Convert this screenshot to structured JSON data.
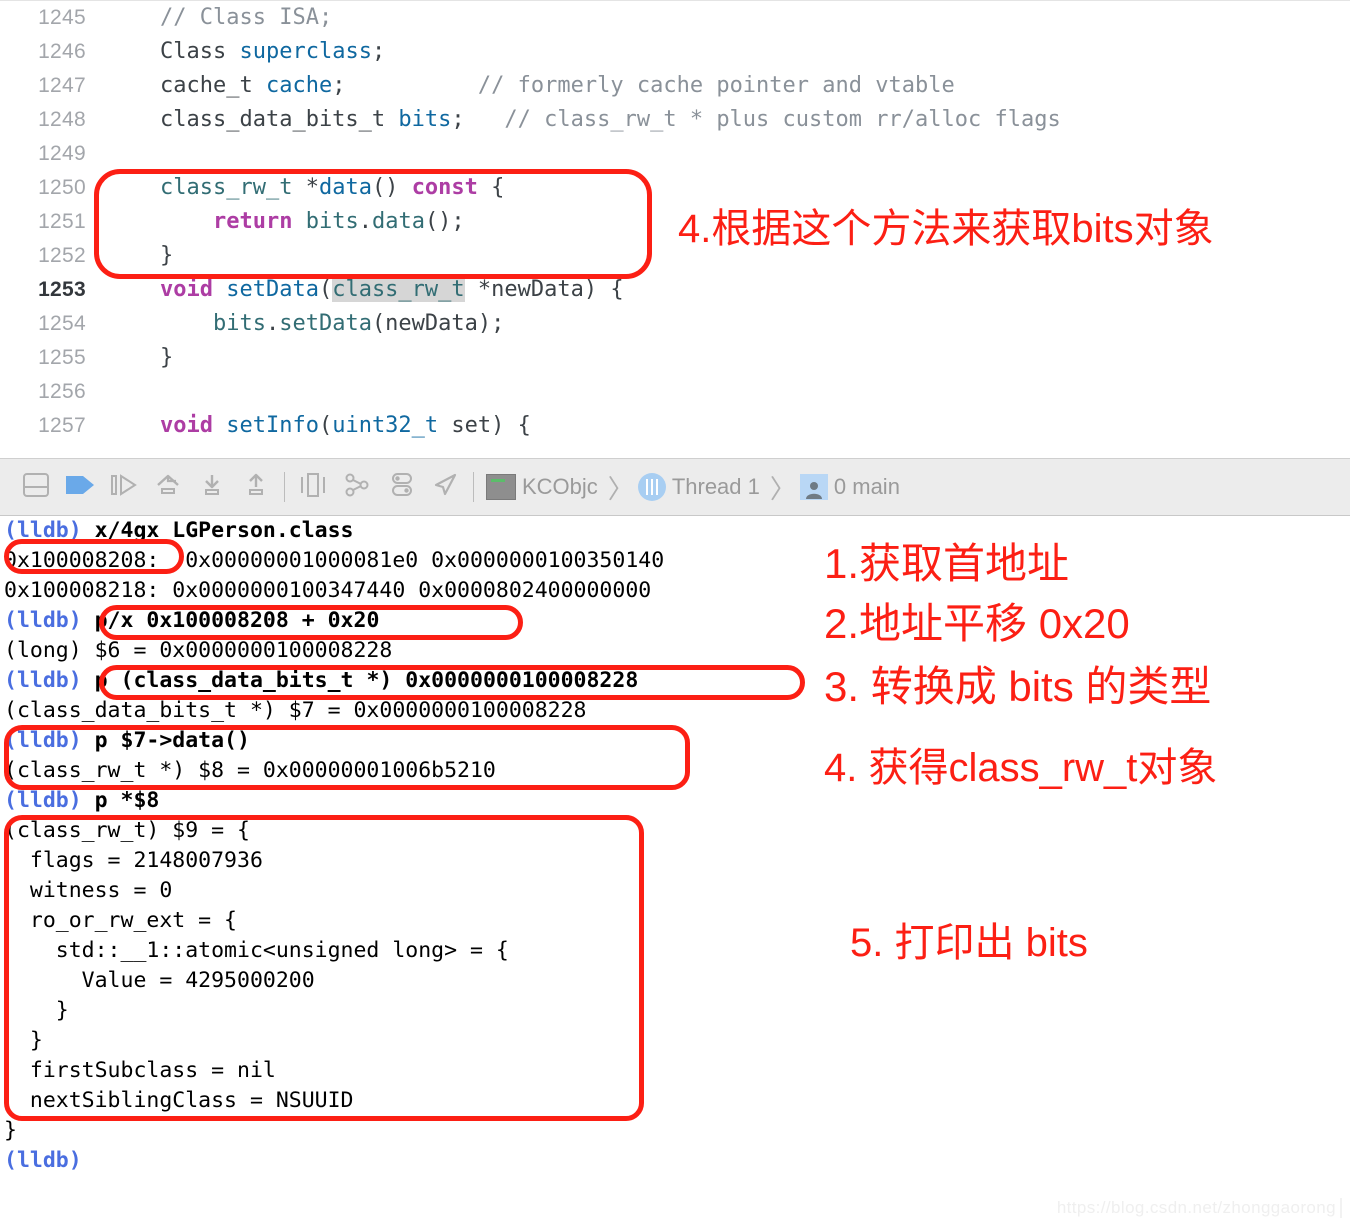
{
  "editor": {
    "lines": [
      {
        "num": "1245",
        "current": false,
        "html": "<span class='cmt'>// Class ISA;</span>"
      },
      {
        "num": "1246",
        "current": false,
        "html": "<span class='typ'>Class </span><span class='blu'>superclass</span>;"
      },
      {
        "num": "1247",
        "current": false,
        "html": "<span class='typ'>cache_t </span><span class='blu'>cache</span>;          <span class='cmt'>// formerly cache pointer and vtable</span>"
      },
      {
        "num": "1248",
        "current": false,
        "html": "<span class='typ'>class_data_bits_t </span><span class='blu'>bits</span>;   <span class='cmt'>// class_rw_t * plus custom rr/alloc flags</span>"
      },
      {
        "num": "1249",
        "current": false,
        "html": ""
      },
      {
        "num": "1250",
        "current": false,
        "html": "<span class='fn'>class_rw_t</span> *<span class='blu'>data</span>() <span class='kw'>const</span> {"
      },
      {
        "num": "1251",
        "current": false,
        "html": "    <span class='kw'>return</span> <span class='fn'>bits</span>.<span class='fn'>data</span>();"
      },
      {
        "num": "1252",
        "current": false,
        "html": "}"
      },
      {
        "num": "1253",
        "current": true,
        "html": "<span class='kw'>void</span> <span class='blu'>setData</span>(<span class='hl fn'>class_rw_t</span> *newData) {"
      },
      {
        "num": "1254",
        "current": false,
        "html": "    <span class='fn'>bits</span>.<span class='fn'>setData</span>(newData);"
      },
      {
        "num": "1255",
        "current": false,
        "html": "}"
      },
      {
        "num": "1256",
        "current": false,
        "html": ""
      },
      {
        "num": "1257",
        "current": false,
        "html": "<span class='kw'>void</span> <span class='blu'>setInfo</span>(<span class='blu'>uint32_t</span> set) {"
      }
    ],
    "plain_lines": [
      "// Class ISA;",
      "Class superclass;",
      "cache_t cache;          // formerly cache pointer and vtable",
      "class_data_bits_t bits;   // class_rw_t * plus custom rr/alloc flags",
      "",
      "class_rw_t *data() const {",
      "    return bits.data();",
      "}",
      "void setData(class_rw_t *newData) {",
      "    bits.setData(newData);",
      "}",
      "",
      "void setInfo(uint32_t set) {"
    ]
  },
  "toolbar": {
    "buttons": [
      {
        "name": "hide-debug-area-button",
        "icon": "panel-icon"
      },
      {
        "name": "continue-button",
        "icon": "continue-icon"
      },
      {
        "name": "step-over-button",
        "icon": "step-over-icon"
      },
      {
        "name": "step-into-button",
        "icon": "step-into-icon"
      },
      {
        "name": "step-down-button",
        "icon": "step-down-icon"
      },
      {
        "name": "step-out-button",
        "icon": "step-out-icon"
      },
      {
        "name": "view-debugging-button",
        "icon": "view-debug-icon"
      },
      {
        "name": "view-hierarchy-button",
        "icon": "hierarchy-icon"
      },
      {
        "name": "debug-settings-button",
        "icon": "toggles-icon"
      },
      {
        "name": "simulate-location-button",
        "icon": "location-arrow-icon"
      }
    ],
    "breadcrumb": {
      "process": "KCObjc",
      "thread": "Thread 1",
      "frame": "0 main",
      "separator": "〉"
    }
  },
  "console": {
    "lines": [
      {
        "prompt": "(lldb)",
        "cmd": " x/4gx LGPerson.class",
        "bold": true
      },
      {
        "prompt": "",
        "cmd": "0x100008208:  0x00000001000081e0 0x0000000100350140",
        "bold": false
      },
      {
        "prompt": "",
        "cmd": "0x100008218: 0x0000000100347440 0x0000802400000000",
        "bold": false
      },
      {
        "prompt": "(lldb)",
        "cmd": " p/x 0x100008208 + 0x20",
        "bold": true
      },
      {
        "prompt": "",
        "cmd": "(long) $6 = 0x0000000100008228",
        "bold": false
      },
      {
        "prompt": "(lldb)",
        "cmd": " p (class_data_bits_t *) 0x0000000100008228",
        "bold": true
      },
      {
        "prompt": "",
        "cmd": "(class_data_bits_t *) $7 = 0x0000000100008228",
        "bold": false
      },
      {
        "prompt": "(lldb)",
        "cmd": " p $7->data()",
        "bold": true
      },
      {
        "prompt": "",
        "cmd": "(class_rw_t *) $8 = 0x00000001006b5210",
        "bold": false
      },
      {
        "prompt": "(lldb)",
        "cmd": " p *$8",
        "bold": true
      },
      {
        "prompt": "",
        "cmd": "(class_rw_t) $9 = {",
        "bold": false
      },
      {
        "prompt": "",
        "cmd": "  flags = 2148007936",
        "bold": false
      },
      {
        "prompt": "",
        "cmd": "  witness = 0",
        "bold": false
      },
      {
        "prompt": "",
        "cmd": "  ro_or_rw_ext = {",
        "bold": false
      },
      {
        "prompt": "",
        "cmd": "    std::__1::atomic<unsigned long> = {",
        "bold": false
      },
      {
        "prompt": "",
        "cmd": "      Value = 4295000200",
        "bold": false
      },
      {
        "prompt": "",
        "cmd": "    }",
        "bold": false
      },
      {
        "prompt": "",
        "cmd": "  }",
        "bold": false
      },
      {
        "prompt": "",
        "cmd": "  firstSubclass = nil",
        "bold": false
      },
      {
        "prompt": "",
        "cmd": "  nextSiblingClass = NSUUID",
        "bold": false
      },
      {
        "prompt": "",
        "cmd": "}",
        "bold": false
      },
      {
        "prompt": "(lldb)",
        "cmd": "",
        "bold": true
      }
    ]
  },
  "annotations": {
    "color": "#fc1f14",
    "notes": [
      {
        "id": "note-4-editor",
        "text": "4.根据这个方法来获取bits对象"
      },
      {
        "id": "note-1",
        "text": "1.获取首地址"
      },
      {
        "id": "note-2",
        "text": "2.地址平移 0x20"
      },
      {
        "id": "note-3",
        "text": "3. 转换成 bits 的类型"
      },
      {
        "id": "note-4-console",
        "text": "4. 获得class_rw_t对象"
      },
      {
        "id": "note-5",
        "text": "5. 打印出 bits"
      }
    ],
    "boxes": [
      {
        "id": "box-data-method"
      },
      {
        "id": "box-first-address"
      },
      {
        "id": "box-offset-cmd"
      },
      {
        "id": "box-cast-cmd"
      },
      {
        "id": "box-data-call"
      },
      {
        "id": "box-class-rw-dump"
      }
    ]
  },
  "watermark": {
    "text": "https://blog.csdn.net/zhonggaorong"
  }
}
